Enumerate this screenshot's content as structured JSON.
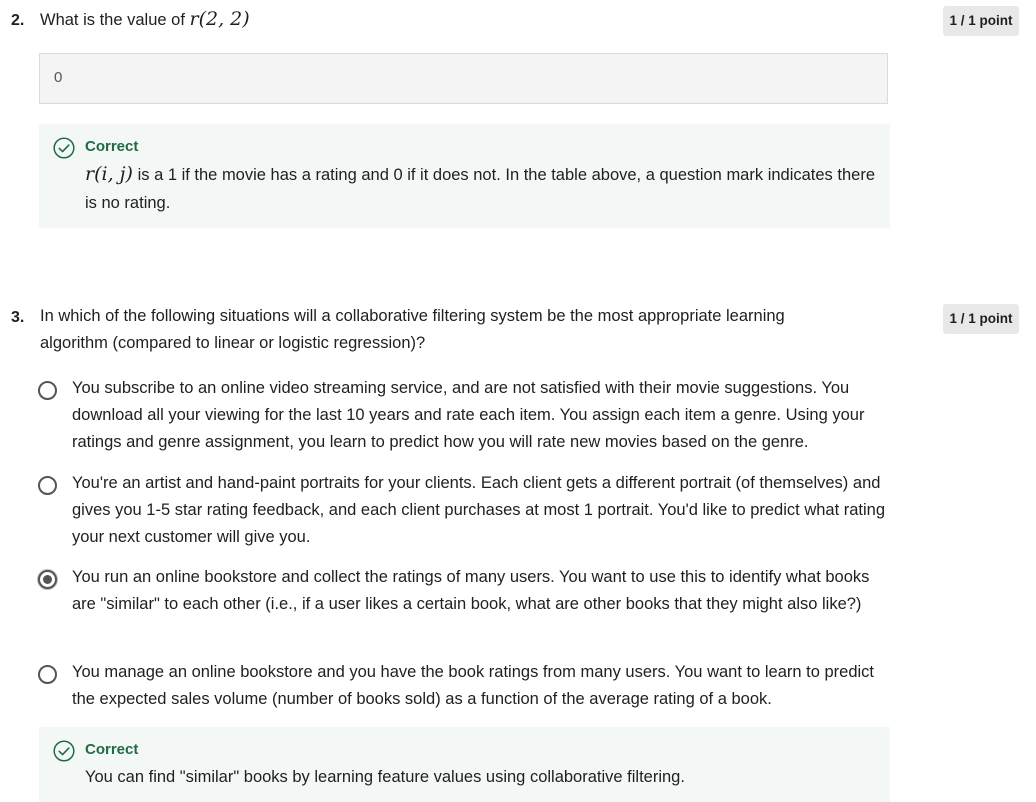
{
  "q2": {
    "number": "2.",
    "text_prefix": "What is the value of",
    "math": "r(2, 2)",
    "points": "1 / 1 point",
    "answer_value": "0",
    "feedback": {
      "title": "Correct",
      "math": "r(i, j)",
      "text": "is a 1 if the movie has a rating and 0 if it does not. In the table above, a question mark indicates there is no rating."
    }
  },
  "q3": {
    "number": "3.",
    "text": "In which of the following situations will a collaborative filtering system be the most appropriate learning algorithm (compared to linear or logistic regression)?",
    "points": "1 / 1 point",
    "options": [
      {
        "text": "You subscribe to an online video streaming service, and are not satisfied with their movie suggestions. You download all your viewing for the last 10 years and rate each item. You assign each item a genre. Using your ratings and genre assignment, you learn to predict how you will rate new movies based on the genre.",
        "selected": false
      },
      {
        "text": "You're an artist and hand-paint portraits for your clients. Each client gets a different portrait (of themselves) and gives you 1-5 star rating feedback, and each client purchases at most 1 portrait. You'd like to predict what rating your next customer will give you.",
        "selected": false
      },
      {
        "text": "You run an online bookstore and collect the ratings of many users. You want to use this to identify what books are \"similar\" to each other (i.e., if a user likes a certain book, what are other books that they might also like?)",
        "selected": true
      },
      {
        "text": "You manage an online bookstore and you have the book ratings from many users. You want to learn to predict the expected sales volume (number of books sold) as a function of the average rating of a book.",
        "selected": false
      }
    ],
    "feedback": {
      "title": "Correct",
      "text": "You can find \"similar\" books by learning feature values using collaborative filtering."
    }
  },
  "colors": {
    "correct_green": "#1e6c43",
    "feedback_bg": "#f3f8f6",
    "badge_bg": "#e8e8e8"
  },
  "icons": [
    "check-circle-icon",
    "radio-button"
  ]
}
